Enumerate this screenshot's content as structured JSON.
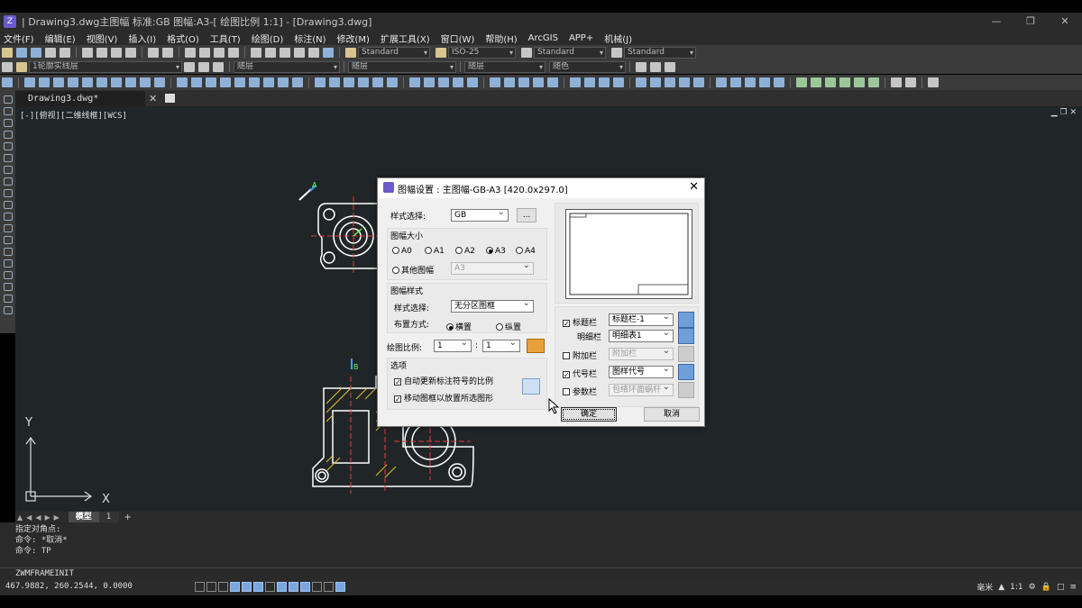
{
  "window": {
    "title": "| Drawing3.dwg主图幅  标准:GB 图幅:A3-[ 绘图比例 1:1] - [Drawing3.dwg]",
    "min": "—",
    "restore": "❐",
    "close": "✕"
  },
  "menu": [
    "文件(F)",
    "编辑(E)",
    "视图(V)",
    "插入(I)",
    "格式(O)",
    "工具(T)",
    "绘图(D)",
    "标注(N)",
    "修改(M)",
    "扩展工具(X)",
    "窗口(W)",
    "帮助(H)",
    "ArcGIS",
    "APP+",
    "机械(J)"
  ],
  "toolbar1": {
    "text_style": "Standard",
    "dim_style": "ISO-25",
    "table_style": "Standard",
    "mleader_style": "Standard"
  },
  "toolbar2": {
    "layer": "1轮廓实线层",
    "color": "随层",
    "linetype": "随层",
    "lineweight": "随层",
    "plotstyle": "随色"
  },
  "doc_tab": {
    "label": "Drawing3.dwg*",
    "close": "✕"
  },
  "viewport": {
    "label": "[-][俯视][二维线框][WCS]",
    "controls": "▁ ❐ ✕"
  },
  "axes": {
    "y": "Y",
    "x": "X"
  },
  "markers": {
    "a": "A",
    "b": "B"
  },
  "layout_tabs": {
    "model": "模型",
    "layout1": "1",
    "add": "+"
  },
  "command": {
    "history": [
      "指定对角点:",
      "命令: *取消*",
      "命令: TP"
    ],
    "input": "ZWMFRAMEINIT"
  },
  "status": {
    "coords": "467.9882, 260.2544, 0.0000",
    "units": "毫米",
    "scale": "1:1"
  },
  "dialog": {
    "title": "图幅设置 : 主图幅-GB-A3 [420.0x297.0]",
    "close": "✕",
    "style_label": "样式选择:",
    "style_value": "GB",
    "browse": "...",
    "size_group": "图幅大小",
    "sizes": [
      "A0",
      "A1",
      "A2",
      "A3",
      "A4"
    ],
    "selected_size": "A3",
    "other_size_label": "其他图幅",
    "other_size_value": "A3",
    "frame_group": "图幅样式",
    "frame_style_label": "样式选择:",
    "frame_style_value": "无分区图框",
    "layout_label": "布置方式:",
    "layout_horizontal": "横置",
    "layout_vertical": "纵置",
    "scale_label": "绘图比例:",
    "scale_left": "1",
    "scale_colon": ":",
    "scale_right": "1",
    "options_group": "选项",
    "opt1": "自动更新标注符号的比例",
    "opt2": "移动图框以放置所选图形",
    "title_block_label": "标题栏",
    "title_block_value": "标题栏-1",
    "detail_label": "明细栏",
    "detail_value": "明细表1",
    "attach_label": "附加栏",
    "attach_value": "附加栏",
    "code_label": "代号栏",
    "code_value": "图样代号",
    "param_label": "参数栏",
    "param_value": "包络环面蜗杆",
    "ok": "确定",
    "cancel": "取消"
  }
}
